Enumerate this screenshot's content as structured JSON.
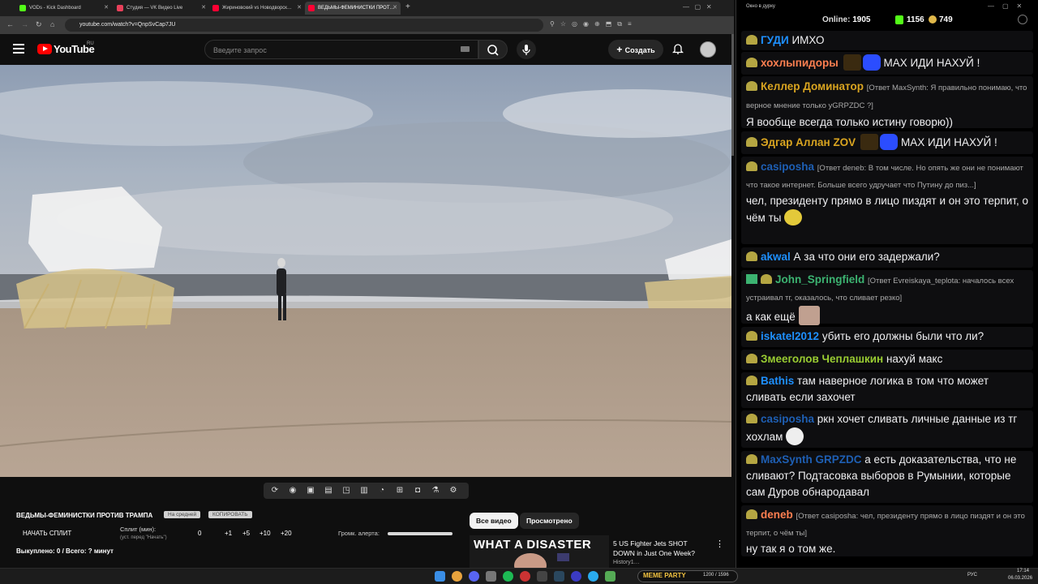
{
  "browser": {
    "tabs": [
      {
        "label": "VODs - Kick Dashboard",
        "color": "#53fc18"
      },
      {
        "label": "Студия — VK Видео Live",
        "color": "#e8405a"
      },
      {
        "label": "Жириновский vs Новодворск…",
        "color": "#ff0033"
      },
      {
        "label": "ВЕДЬМЫ-ФЕМИНИСТКИ ПРОТ…",
        "color": "#ff0033"
      }
    ],
    "new_tab": "+",
    "url": "youtube.com/watch?v=QnpSvCap7JU"
  },
  "youtube": {
    "logo": "YouTube",
    "region": "RU",
    "search_placeholder": "Введите запрос",
    "create_label": "Создать",
    "icons": {
      "menu": "menu-icon",
      "search": "search-icon",
      "mic": "mic-icon",
      "bell": "bell-icon"
    }
  },
  "player_tools": [
    "loop-icon",
    "broadcast-icon",
    "screenshot-icon",
    "clip-icon",
    "pip-icon",
    "frames-icon",
    "speed-icon",
    "add-icon",
    "camera-icon",
    "lab-icon",
    "gear-icon"
  ],
  "overlay": {
    "title": "ВЕДЬМЫ-ФЕМИНИСТКИ ПРОТИВ ТРАМПА",
    "badge_1": "На средней",
    "badge_2": "КОПИРОВАТЬ",
    "start_split": "НАЧАТЬ СПЛИТ",
    "split_label": "Сплит (мин):",
    "split_hint": "(уст. перед \"Начать\")",
    "split_values": [
      "0",
      "+1",
      "+5",
      "+10",
      "+20"
    ],
    "volume_label": "Громк. алерта:",
    "bought": "Выкуплено: 0 / Всего: ? минут"
  },
  "feed": {
    "chip_all": "Все видео",
    "chip_watched": "Просмотрено",
    "thumb_text": "WHAT A DISASTER",
    "video_title": "5 US Fighter Jets SHOT DOWN in Just One Week?",
    "channel": "History1…"
  },
  "chat": {
    "window_title": "Окно в дурку",
    "online_label": "Online:",
    "online_count": "1905",
    "kick_count": "1156",
    "coin_count": "749",
    "messages": [
      {
        "user": "ГУДИ",
        "color": "#1e90ff",
        "reply": "",
        "text": "ИМХО"
      },
      {
        "user": "хохлыпидоры",
        "color": "#ff7f50",
        "reply": "",
        "text": "МАХ ИДИ НАХУЙ !"
      },
      {
        "user": "Келлер Доминатор",
        "color": "#daa520",
        "reply": "[Ответ MaxSynth: Я правильно понимаю, что верное мнение только уGRPZDC ?]",
        "text": "Я вообще всегда только истину говорю))"
      },
      {
        "user": "Эдгар Аллан ZOV",
        "color": "#daa520",
        "reply": "",
        "text": "МАХ ИДИ НАХУЙ !"
      },
      {
        "user": "casiposha",
        "color": "#1e5fb4",
        "reply": "[Ответ deneb: В том числе. Но опять же они не понимают что такое интернет. Больше всего удручает что Путину до пиз...]",
        "text": "чел, президенту прямо в лицо пиздят и он это терпит, о чём ты"
      },
      {
        "user": "akwal",
        "color": "#1e90ff",
        "reply": "",
        "text": "А за что они его задержали?"
      },
      {
        "user": "John_Springfield",
        "color": "#3cb371",
        "reply": "[Ответ Evreiskaya_teplota: началось всех устраивал тг, оказалось, что сливает резко]",
        "text": "а как ещё"
      },
      {
        "user": "iskatel2012",
        "color": "#1e90ff",
        "reply": "",
        "text": "убить его должны были что ли?"
      },
      {
        "user": "Змееголов Чеплашкин",
        "color": "#9acd32",
        "reply": "",
        "text": "нахуй макс"
      },
      {
        "user": "Bathis",
        "color": "#1e90ff",
        "reply": "",
        "text": "там наверное логика в том что может сливать если захочет"
      },
      {
        "user": "casiposha",
        "color": "#1e5fb4",
        "reply": "",
        "text": "ркн хочет сливать личные данные из тг хохлам"
      },
      {
        "user": "MaxSynth",
        "mention": "GRPZDC",
        "color": "#1e5fb4",
        "reply": "",
        "text": "а есть доказательства, что не сливают? Подтасовка выборов в Румынии, которые сам Дуров обнародавал"
      },
      {
        "user": "deneb",
        "color": "#ff7f50",
        "reply": "[Ответ casiposha: чел, президенту прямо в лицо пиздят и он это терпит, о чём ты]",
        "text": "ну так я о том же."
      }
    ]
  },
  "taskbar": {
    "widget": "MEME PARTY",
    "widget_value": "1200 / 1596",
    "lang": "РУС",
    "time": "17:14",
    "date": "06.03.2026"
  },
  "colors": {
    "youtube_red": "#ff0000",
    "kick_green": "#53fc18"
  }
}
